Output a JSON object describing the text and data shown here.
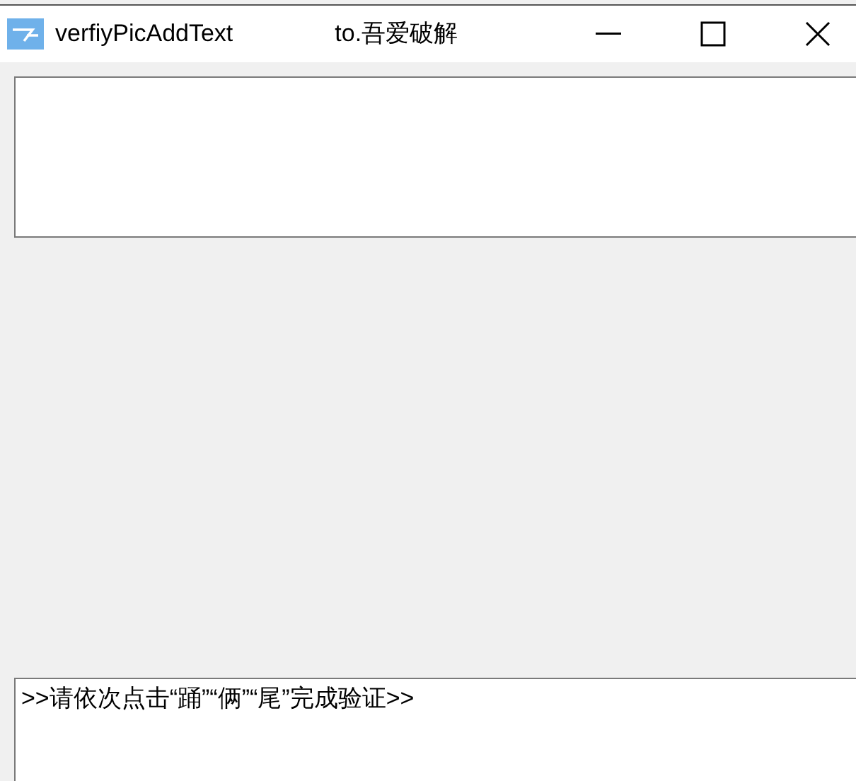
{
  "window": {
    "title": "verfiyPicAddText",
    "caption": "to.吾爱破解"
  },
  "message_box": {
    "value": ">>请依次点击“踊”“俩”“尾”完成验证>>"
  }
}
